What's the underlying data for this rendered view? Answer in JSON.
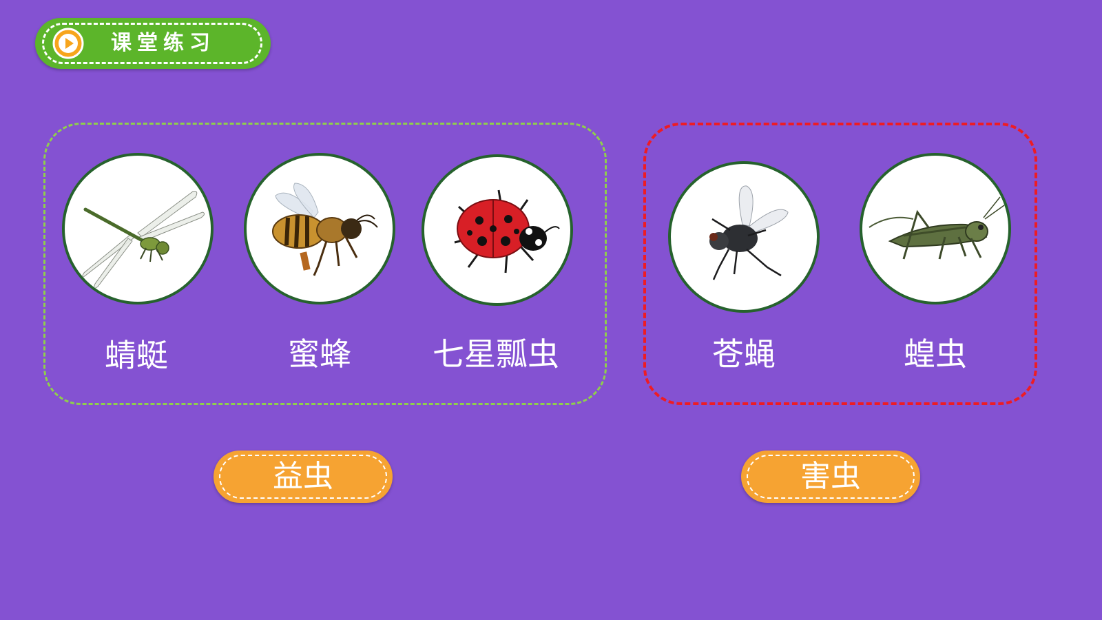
{
  "header": {
    "title": "课堂练习",
    "icon": "play-icon"
  },
  "groups": [
    {
      "kind": "beneficial",
      "border_color": "#8fcf4b",
      "tag": "益虫",
      "insects": [
        {
          "name": "蜻蜓",
          "icon": "dragonfly-image"
        },
        {
          "name": "蜜蜂",
          "icon": "bee-image"
        },
        {
          "name": "七星瓢虫",
          "icon": "ladybug-image"
        }
      ]
    },
    {
      "kind": "pest",
      "border_color": "#ee1c24",
      "tag": "害虫",
      "insects": [
        {
          "name": "苍蝇",
          "icon": "fly-image"
        },
        {
          "name": "蝗虫",
          "icon": "locust-image"
        }
      ]
    }
  ],
  "colors": {
    "background": "#8452d2",
    "header_badge": "#5cb52a",
    "tag": "#f6a332",
    "circle_border": "#26622d"
  }
}
